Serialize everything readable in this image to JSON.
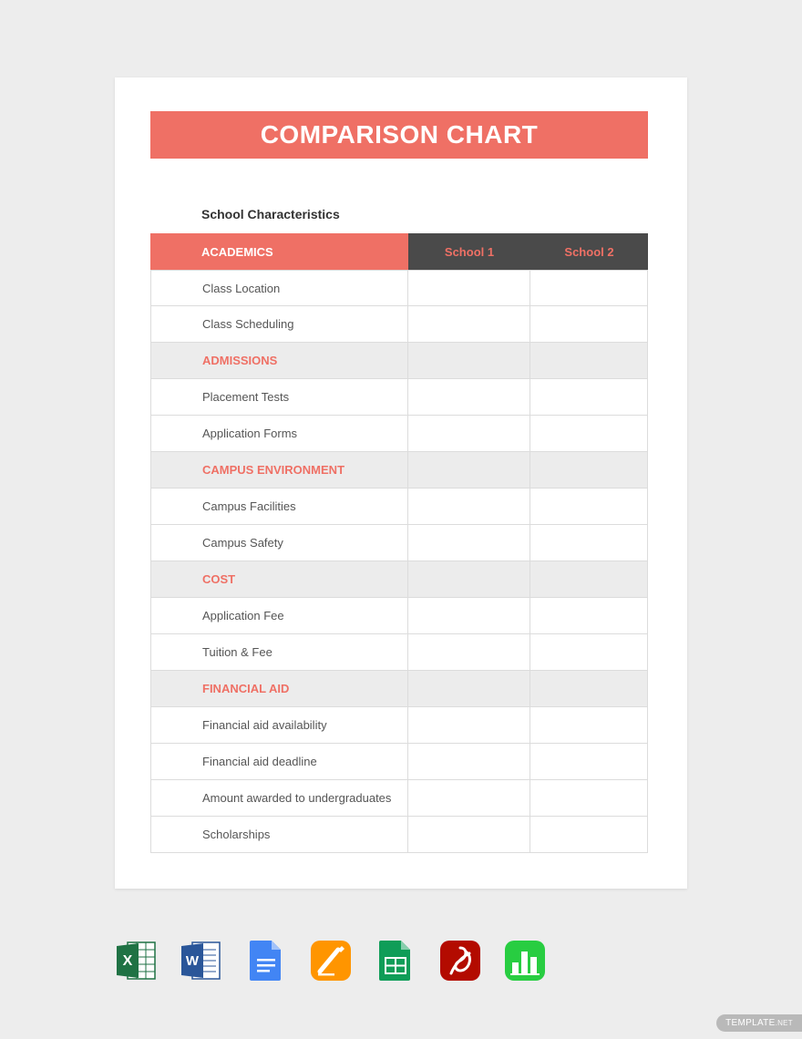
{
  "title": "COMPARISON CHART",
  "subtitle": "School Characteristics",
  "columns": {
    "c0": "ACADEMICS",
    "c1": "School 1",
    "c2": "School 2"
  },
  "sections": [
    {
      "name": "ACADEMICS",
      "rows": [
        "Class Location",
        "Class Scheduling"
      ]
    },
    {
      "name": "ADMISSIONS",
      "rows": [
        "Placement Tests",
        "Application Forms"
      ]
    },
    {
      "name": "CAMPUS ENVIRONMENT",
      "rows": [
        "Campus Facilities",
        "Campus Safety"
      ]
    },
    {
      "name": "COST",
      "rows": [
        "Application Fee",
        "Tuition & Fee"
      ]
    },
    {
      "name": "FINANCIAL AID",
      "rows": [
        "Financial aid availability",
        "Financial aid deadline",
        "Amount awarded to undergraduates",
        "Scholarships"
      ]
    }
  ],
  "icons": [
    "excel",
    "word",
    "google-docs",
    "apple-pages",
    "google-sheets",
    "pdf",
    "apple-numbers"
  ],
  "badge": {
    "brand": "TEMPLATE",
    "tld": ".NET"
  },
  "colors": {
    "accent": "#ef7065",
    "dark": "#4a4a4a",
    "section_bg": "#ececec"
  }
}
